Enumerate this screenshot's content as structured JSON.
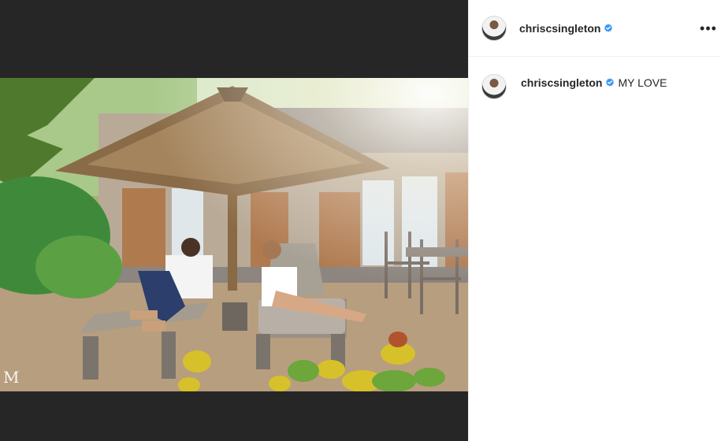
{
  "post": {
    "username": "chriscsingleton",
    "verified": true,
    "more_icon": "more-horizontal-icon",
    "more_label": "•••",
    "caption": "MY LOVE",
    "watermark": "M"
  },
  "colors": {
    "media_background": "#262626",
    "verified_badge": "#3897f0",
    "divider": "#efefef"
  }
}
